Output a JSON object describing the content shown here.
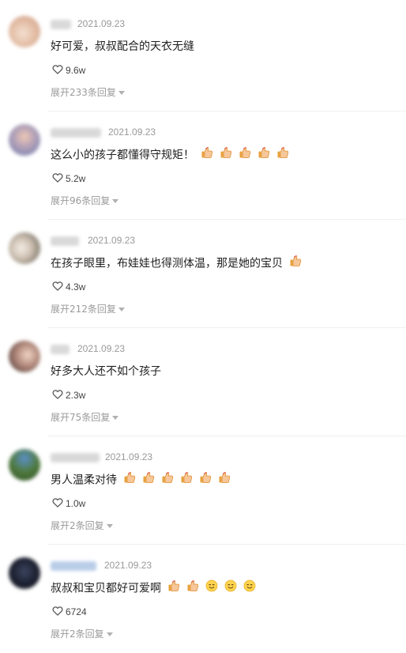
{
  "colors": {
    "text": "#1f1f1f",
    "meta": "#999999",
    "divider": "#f0f0f0"
  },
  "comments": [
    {
      "date": "2021.09.23",
      "text": "好可爱，叔叔配合的天衣无缝",
      "emojis": [],
      "likes": "9.6w",
      "replies": "展开233条回复"
    },
    {
      "date": "2021.09.23",
      "text": "这么小的孩子都懂得守规矩！",
      "emojis": [
        "thumbs-up",
        "thumbs-up",
        "thumbs-up",
        "thumbs-up",
        "thumbs-up"
      ],
      "likes": "5.2w",
      "replies": "展开96条回复"
    },
    {
      "date": "2021.09.23",
      "text": "在孩子眼里，布娃娃也得测体温，那是她的宝贝",
      "emojis": [
        "thumbs-up"
      ],
      "likes": "4.3w",
      "replies": "展开212条回复"
    },
    {
      "date": "2021.09.23",
      "text": "好多大人还不如个孩子",
      "emojis": [],
      "likes": "2.3w",
      "replies": "展开75条回复"
    },
    {
      "date": "2021.09.23",
      "text": "男人温柔对待",
      "emojis": [
        "thumbs-up",
        "thumbs-up",
        "thumbs-up",
        "thumbs-up",
        "thumbs-up",
        "thumbs-up"
      ],
      "likes": "1.0w",
      "replies": "展开2条回复"
    },
    {
      "date": "2021.09.23",
      "text": "叔叔和宝贝都好可爱啊",
      "emojis": [
        "thumbs-up",
        "thumbs-up",
        "smile",
        "smile",
        "smile"
      ],
      "likes": "6724",
      "replies": "展开2条回复"
    }
  ]
}
